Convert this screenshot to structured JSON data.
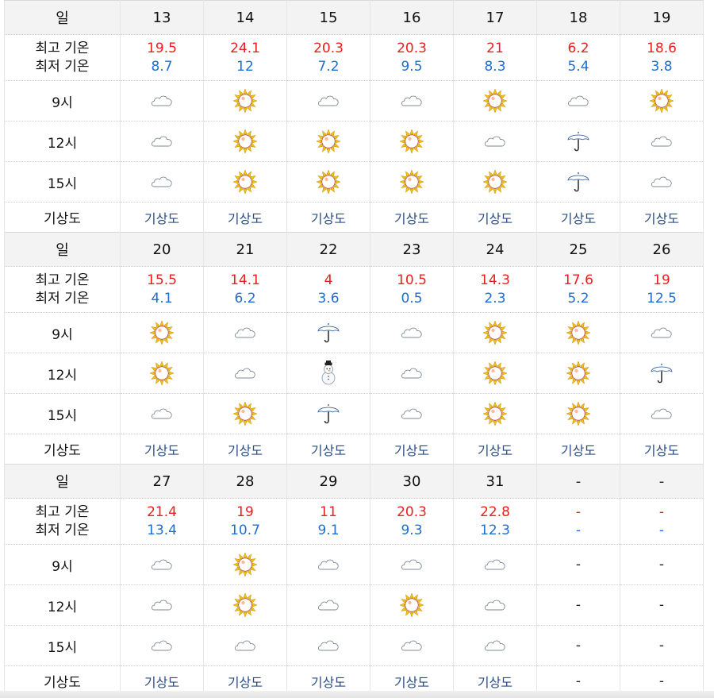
{
  "labels": {
    "day": "일",
    "high": "최고 기온",
    "low": "최저 기온",
    "t9": "9시",
    "t12": "12시",
    "t15": "15시",
    "map": "기상도"
  },
  "weeks": [
    {
      "days": [
        {
          "day": "13",
          "high": "19.5",
          "low": "8.7",
          "w9": "cloud",
          "w12": "cloud",
          "w15": "cloud",
          "map": "기상도"
        },
        {
          "day": "14",
          "high": "24.1",
          "low": "12",
          "w9": "sun",
          "w12": "sun",
          "w15": "sun",
          "map": "기상도"
        },
        {
          "day": "15",
          "high": "20.3",
          "low": "7.2",
          "w9": "cloud",
          "w12": "sun",
          "w15": "sun",
          "map": "기상도"
        },
        {
          "day": "16",
          "high": "20.3",
          "low": "9.5",
          "w9": "cloud",
          "w12": "sun",
          "w15": "sun",
          "map": "기상도"
        },
        {
          "day": "17",
          "high": "21",
          "low": "8.3",
          "w9": "sun",
          "w12": "cloud",
          "w15": "sun",
          "map": "기상도"
        },
        {
          "day": "18",
          "high": "6.2",
          "low": "5.4",
          "w9": "cloud",
          "w12": "umbrella",
          "w15": "umbrella",
          "map": "기상도"
        },
        {
          "day": "19",
          "high": "18.6",
          "low": "3.8",
          "w9": "sun",
          "w12": "cloud",
          "w15": "cloud",
          "map": "기상도"
        }
      ]
    },
    {
      "days": [
        {
          "day": "20",
          "high": "15.5",
          "low": "4.1",
          "w9": "sun",
          "w12": "sun",
          "w15": "cloud",
          "map": "기상도"
        },
        {
          "day": "21",
          "high": "14.1",
          "low": "6.2",
          "w9": "cloud",
          "w12": "cloud",
          "w15": "sun",
          "map": "기상도"
        },
        {
          "day": "22",
          "high": "4",
          "low": "3.6",
          "w9": "umbrella",
          "w12": "snowman",
          "w15": "umbrella",
          "map": "기상도"
        },
        {
          "day": "23",
          "high": "10.5",
          "low": "0.5",
          "w9": "cloud",
          "w12": "cloud",
          "w15": "cloud",
          "map": "기상도"
        },
        {
          "day": "24",
          "high": "14.3",
          "low": "2.3",
          "w9": "sun",
          "w12": "sun",
          "w15": "sun",
          "map": "기상도"
        },
        {
          "day": "25",
          "high": "17.6",
          "low": "5.2",
          "w9": "sun",
          "w12": "sun",
          "w15": "sun",
          "map": "기상도"
        },
        {
          "day": "26",
          "high": "19",
          "low": "12.5",
          "w9": "cloud",
          "w12": "umbrella",
          "w15": "cloud",
          "map": "기상도"
        }
      ]
    },
    {
      "days": [
        {
          "day": "27",
          "high": "21.4",
          "low": "13.4",
          "w9": "cloud",
          "w12": "cloud",
          "w15": "cloud",
          "map": "기상도"
        },
        {
          "day": "28",
          "high": "19",
          "low": "10.7",
          "w9": "sun",
          "w12": "sun",
          "w15": "cloud",
          "map": "기상도"
        },
        {
          "day": "29",
          "high": "11",
          "low": "9.1",
          "w9": "cloud",
          "w12": "cloud",
          "w15": "cloud",
          "map": "기상도"
        },
        {
          "day": "30",
          "high": "20.3",
          "low": "9.3",
          "w9": "cloud",
          "w12": "sun",
          "w15": "cloud",
          "map": "기상도"
        },
        {
          "day": "31",
          "high": "22.8",
          "low": "12.3",
          "w9": "cloud",
          "w12": "cloud",
          "w15": "cloud",
          "map": "기상도"
        },
        {
          "day": "-",
          "high": "-",
          "low": "-",
          "w9": "-",
          "w12": "-",
          "w15": "-",
          "map": "-"
        },
        {
          "day": "-",
          "high": "-",
          "low": "-",
          "w9": "-",
          "w12": "-",
          "w15": "-",
          "map": "-"
        }
      ]
    }
  ],
  "icons": {
    "sun": "sun-icon",
    "cloud": "cloud-icon",
    "umbrella": "umbrella-icon",
    "snowman": "snowman-icon"
  },
  "colors": {
    "high": "#e8211d",
    "low": "#1c6fd6",
    "link": "#2a4d86",
    "header_bg": "#f3f3f3"
  }
}
